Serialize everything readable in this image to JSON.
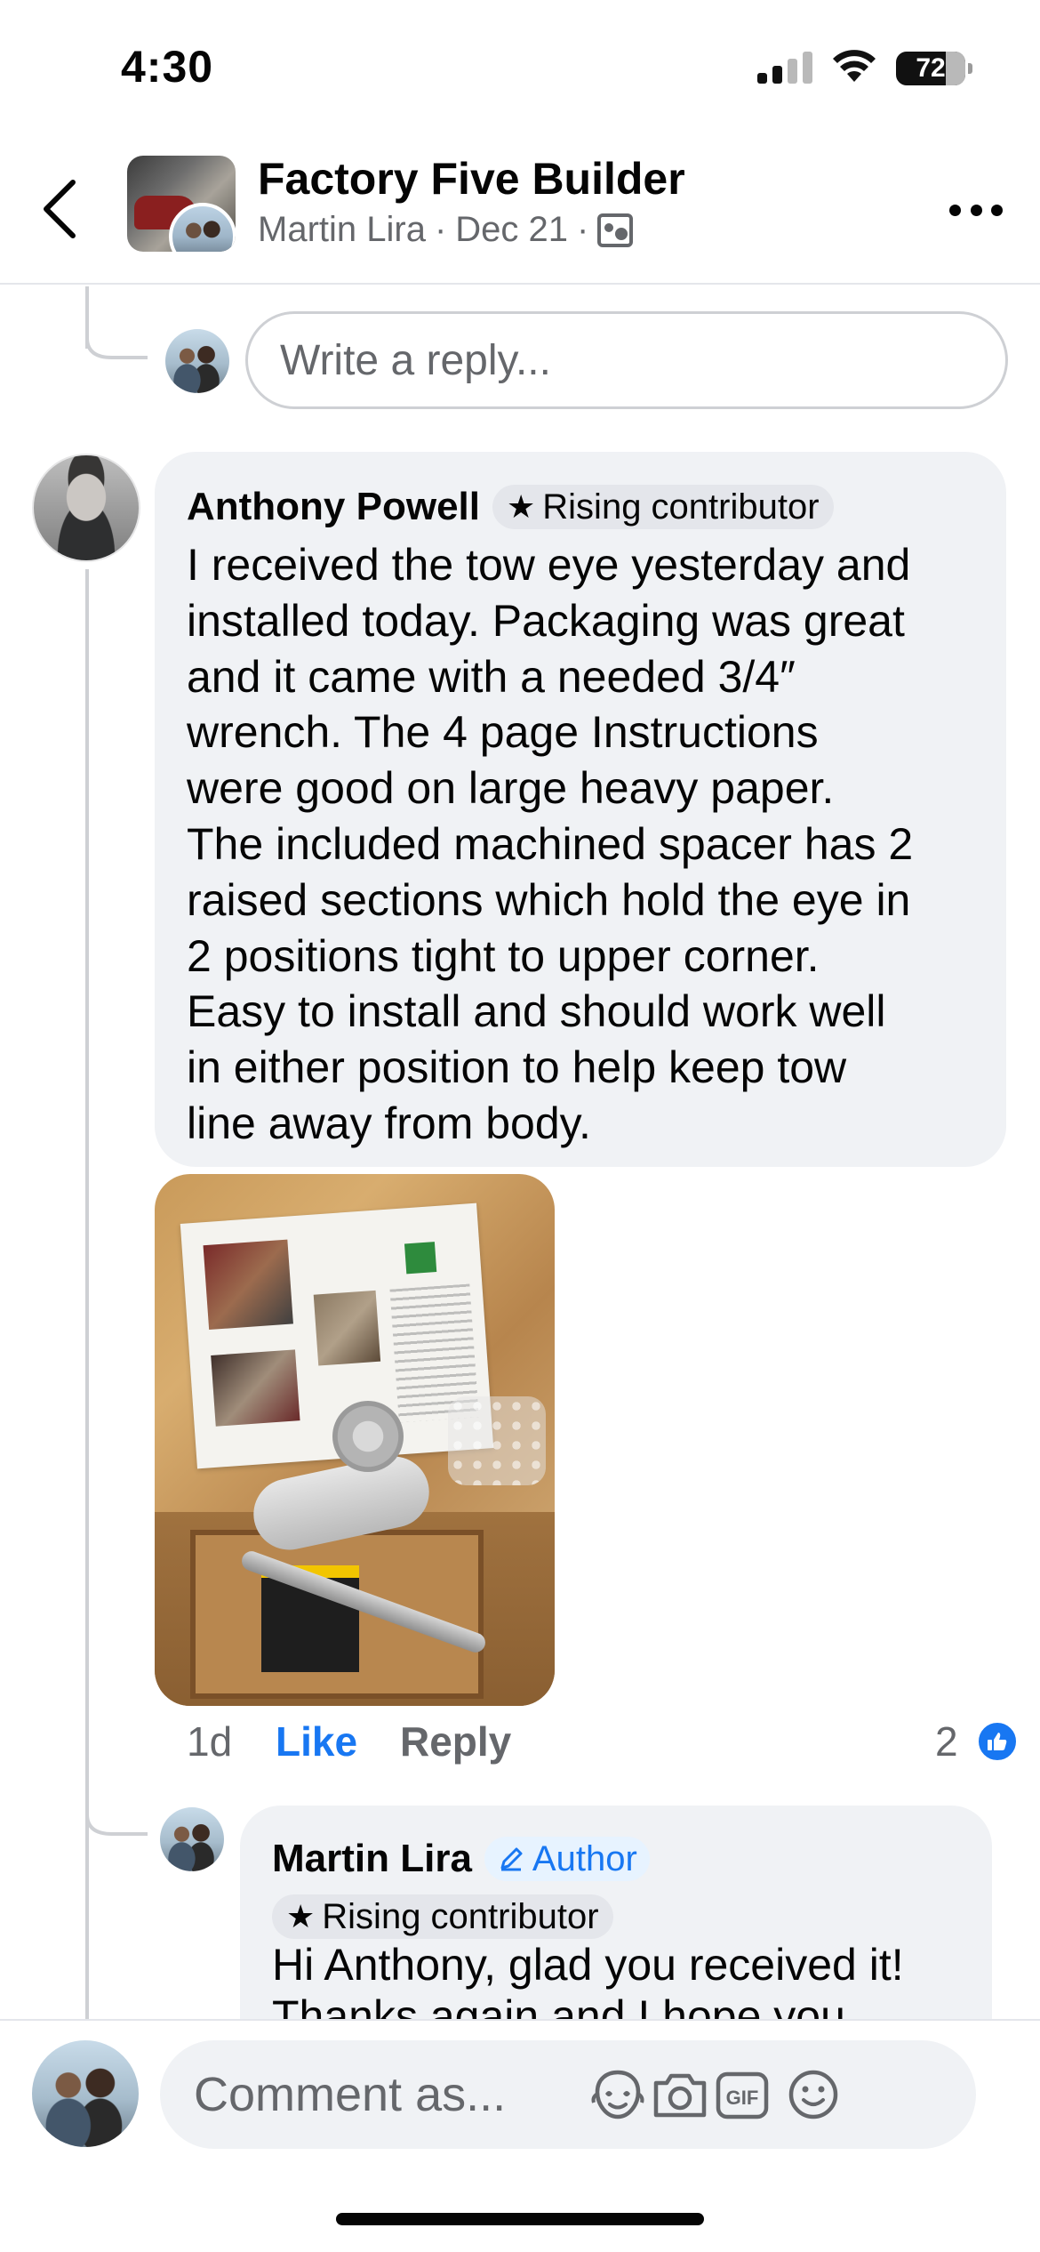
{
  "status_bar": {
    "time": "4:30",
    "battery": "72"
  },
  "header": {
    "title": "Factory Five Builder",
    "author": "Martin Lira",
    "separator": "·",
    "date": "Dec 21"
  },
  "reply_box": {
    "placeholder": "Write a reply..."
  },
  "comment": {
    "author": "Anthony Powell",
    "badge": "Rising contributor",
    "text": "I received the tow eye yesterday and\ninstalled today.  Packaging was great\nand it came with a needed 3/4″\nwrench.  The 4 page Instructions\nwere good on large heavy paper.\nThe included machined spacer has 2\nraised sections which hold the eye in\n2 positions tight to upper corner.\nEasy to install and should work well\nin either position to help keep tow\nline away from body.",
    "time": "1d",
    "like_label": "Like",
    "reply_label": "Reply",
    "reaction_count": "2"
  },
  "reply": {
    "author": "Martin Lira",
    "author_badge": "Author",
    "badge": "Rising contributor",
    "text": "Hi Anthony, glad you received it!\nThanks again and I hope you"
  },
  "composer": {
    "placeholder": "Comment as..."
  },
  "colors": {
    "link_blue": "#1877f2",
    "bubble_gray": "#f0f2f5",
    "secondary_text": "#65676b"
  }
}
